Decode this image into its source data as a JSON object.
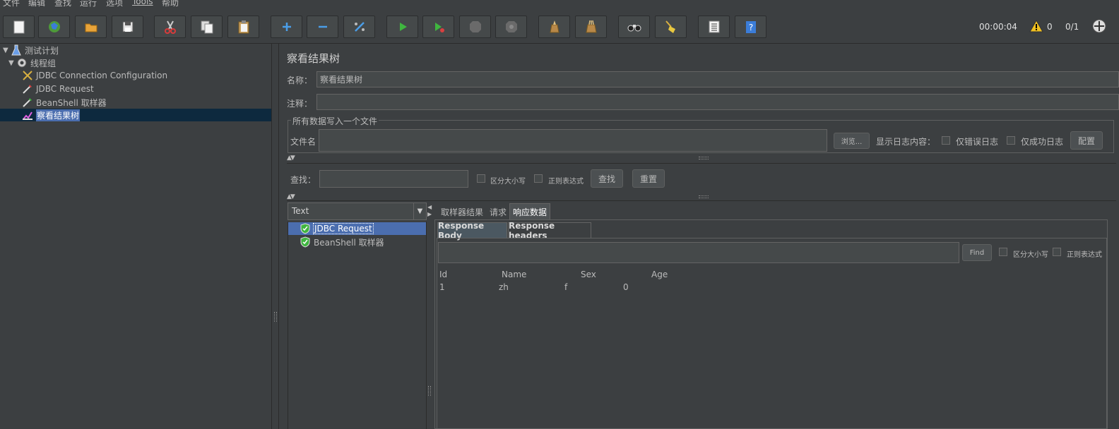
{
  "menu": [
    "文件",
    "编辑",
    "查找",
    "运行",
    "选项",
    "Tools",
    "帮助"
  ],
  "toolbar": {
    "buttons": [
      "new-icon",
      "templates-icon",
      "open-icon",
      "save-icon",
      "cut-icon",
      "copy-icon",
      "paste-icon",
      "expand-icon",
      "collapse-icon",
      "toggle-icon",
      "start-icon",
      "start-no-pause-icon",
      "stop-icon",
      "shutdown-icon",
      "clear-icon",
      "clear-all-icon",
      "search-icon",
      "reset-search-icon",
      "function-helper-icon",
      "help-icon"
    ],
    "elapsed": "00:00:04",
    "warnings": "0",
    "threads": "0/1"
  },
  "tree": {
    "items": [
      {
        "label": "测试计划",
        "icon": "test-plan-icon"
      },
      {
        "label": "线程组",
        "icon": "thread-group-icon"
      },
      {
        "label": "JDBC Connection Configuration",
        "icon": "config-tools-icon"
      },
      {
        "label": "JDBC Request",
        "icon": "sampler-icon"
      },
      {
        "label": "BeanShell 取样器",
        "icon": "sampler-icon"
      },
      {
        "label": "察看结果树",
        "icon": "listener-icon"
      }
    ]
  },
  "panel": {
    "title": "察看结果树",
    "name_label": "名称：",
    "name_value": "察看结果树",
    "comment_label": "注释：",
    "comment_value": "",
    "file_group_title": "所有数据写入一个文件",
    "filename_label": "文件名",
    "filename_value": "",
    "browse_label": "浏览...",
    "log_content_label": "显示日志内容：",
    "errors_only_label": "仅错误日志",
    "success_only_label": "仅成功日志",
    "configure_label": "配置",
    "search_label": "查找：",
    "search_value": "",
    "case_sensitive_label": "区分大小写",
    "regex_label": "正则表达式",
    "find_label": "查找",
    "reset_label": "重置"
  },
  "results": {
    "renderer": "Text",
    "items": [
      {
        "label": "JDBC Request",
        "status": "success"
      },
      {
        "label": "BeanShell 取样器",
        "status": "success"
      }
    ]
  },
  "tabs": [
    "取样器结果",
    "请求",
    "响应数据"
  ],
  "subtabs": [
    "Response Body",
    "Response headers"
  ],
  "response": {
    "find_label": "Find",
    "case_sensitive_label": "区分大小写",
    "regex_label": "正则表达式",
    "headers": [
      "Id",
      "Name",
      "Sex",
      "Age"
    ],
    "rows": [
      [
        "1",
        "zh",
        "f",
        "0"
      ]
    ]
  }
}
